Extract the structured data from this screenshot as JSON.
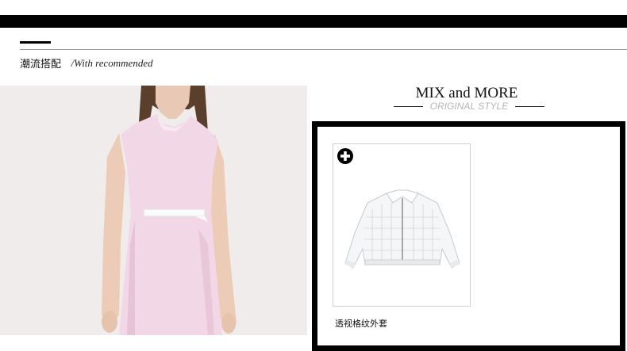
{
  "section": {
    "title_cn": "潮流搭配",
    "title_en": "/With recommended"
  },
  "mix": {
    "title": "MIX and MORE",
    "subtitle": "ORIGINAL STYLE"
  },
  "product": {
    "name": "透视格纹外套",
    "add_icon": "plus-circle-icon"
  },
  "colors": {
    "accent": "#000000",
    "dress": "#f2d7e6",
    "background_photo": "#efeceb"
  }
}
